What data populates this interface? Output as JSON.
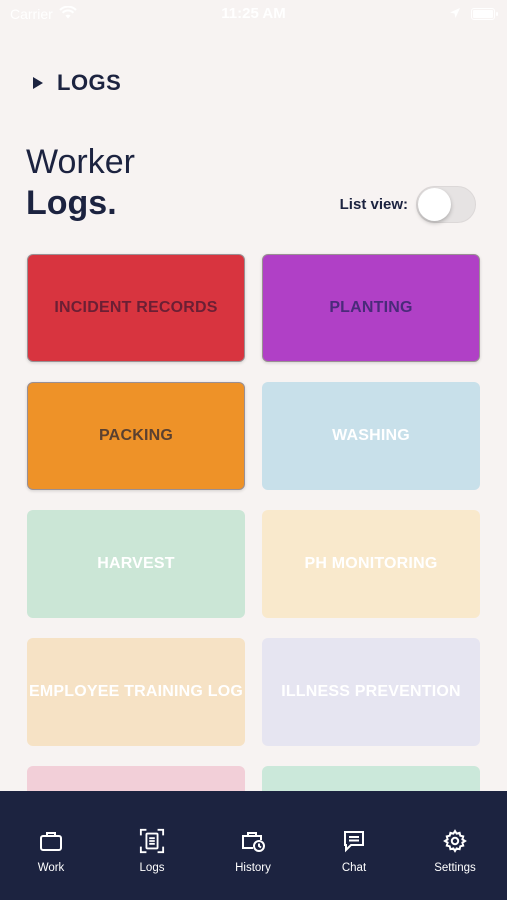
{
  "status_bar": {
    "carrier": "Carrier",
    "time": "11:25 AM",
    "icons": [
      "wifi-icon",
      "location-arrow-icon",
      "battery-icon"
    ]
  },
  "header": {
    "breadcrumb": "LOGS",
    "title_line1": "Worker",
    "title_line2": "Logs."
  },
  "list_view": {
    "label": "List view:",
    "enabled": false
  },
  "cards": [
    {
      "label": "INCIDENT RECORDS",
      "bg": "#d8343f",
      "text": "#6b1f34"
    },
    {
      "label": "PLANTING",
      "bg": "#b040c6",
      "text": "#4a2a7a"
    },
    {
      "label": "PACKING",
      "bg": "#ee9228",
      "text": "#5a4030"
    },
    {
      "label": "WASHING",
      "bg": "#c8e0ea",
      "text": "#ffffff"
    },
    {
      "label": "HARVEST",
      "bg": "#cbe6d6",
      "text": "#ffffff"
    },
    {
      "label": "PH MONITORING",
      "bg": "#f9e9cc",
      "text": "#ffffff"
    },
    {
      "label": "EMPLOYEE TRAINING LOG",
      "bg": "#f6e2c5",
      "text": "#ffffff"
    },
    {
      "label": "ILLNESS PREVENTION",
      "bg": "#e6e5f1",
      "text": "#ffffff"
    },
    {
      "label": "",
      "bg": "#f2cfd8",
      "text": "#ffffff"
    },
    {
      "label": "",
      "bg": "#cbe8da",
      "text": "#ffffff"
    }
  ],
  "bottom_nav": {
    "items": [
      {
        "label": "Work",
        "icon": "briefcase-icon"
      },
      {
        "label": "Logs",
        "icon": "logs-icon"
      },
      {
        "label": "History",
        "icon": "history-icon"
      },
      {
        "label": "Chat",
        "icon": "chat-icon"
      },
      {
        "label": "Settings",
        "icon": "gear-icon"
      }
    ]
  }
}
